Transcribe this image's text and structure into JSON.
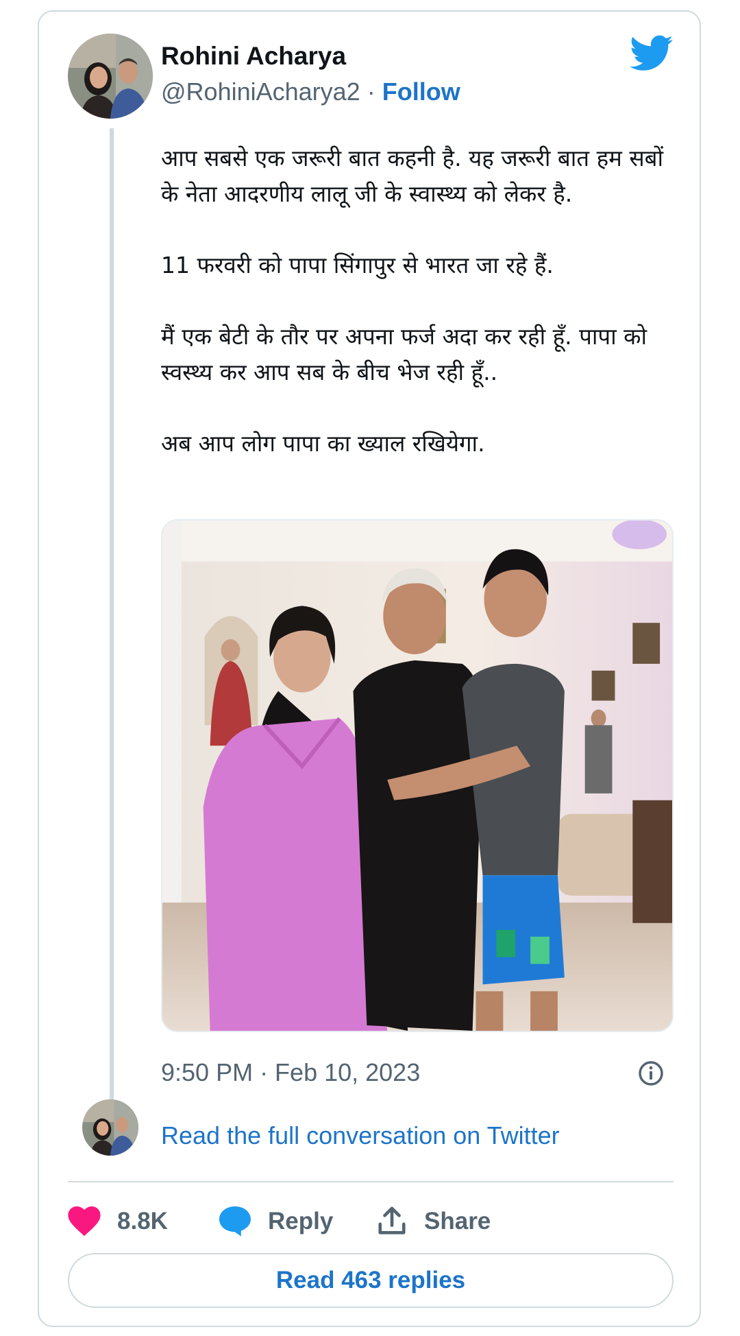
{
  "author": {
    "name": "Rohini Acharya",
    "handle": "@RohiniAcharya2",
    "separator": "·",
    "follow_label": "Follow"
  },
  "tweet": {
    "paragraphs": [
      "आप सबसे एक जरूरी बात कहनी है. यह जरूरी बात हम सबों के नेता आदरणीय लालू जी के स्वास्थ्य को लेकर है.",
      "11 फरवरी को पापा सिंगापुर से भारत जा रहे हैं.",
      "मैं एक बेटी के तौर पर अपना फर्ज अदा कर रही हूँ. पापा को स्वस्थ्य कर आप सब के बीच भेज रही हूँ..",
      "अब आप लोग पापा का ख्याल रखियेगा."
    ],
    "timestamp": "9:50 PM · Feb 10, 2023"
  },
  "links": {
    "full_conversation": "Read the full conversation on Twitter"
  },
  "actions": {
    "likes": "8.8K",
    "reply_label": "Reply",
    "share_label": "Share",
    "read_replies": "Read 463 replies"
  },
  "icons": {
    "brand": "twitter-bird-icon",
    "info": "info-icon",
    "like": "heart-icon",
    "reply": "speech-bubble-icon",
    "share": "share-upload-icon"
  },
  "colors": {
    "twitter_blue": "#1d9bf0",
    "link_blue": "#1d74c9",
    "like_pink": "#f91880",
    "secondary_text": "#536471",
    "border": "#cfd9de"
  }
}
